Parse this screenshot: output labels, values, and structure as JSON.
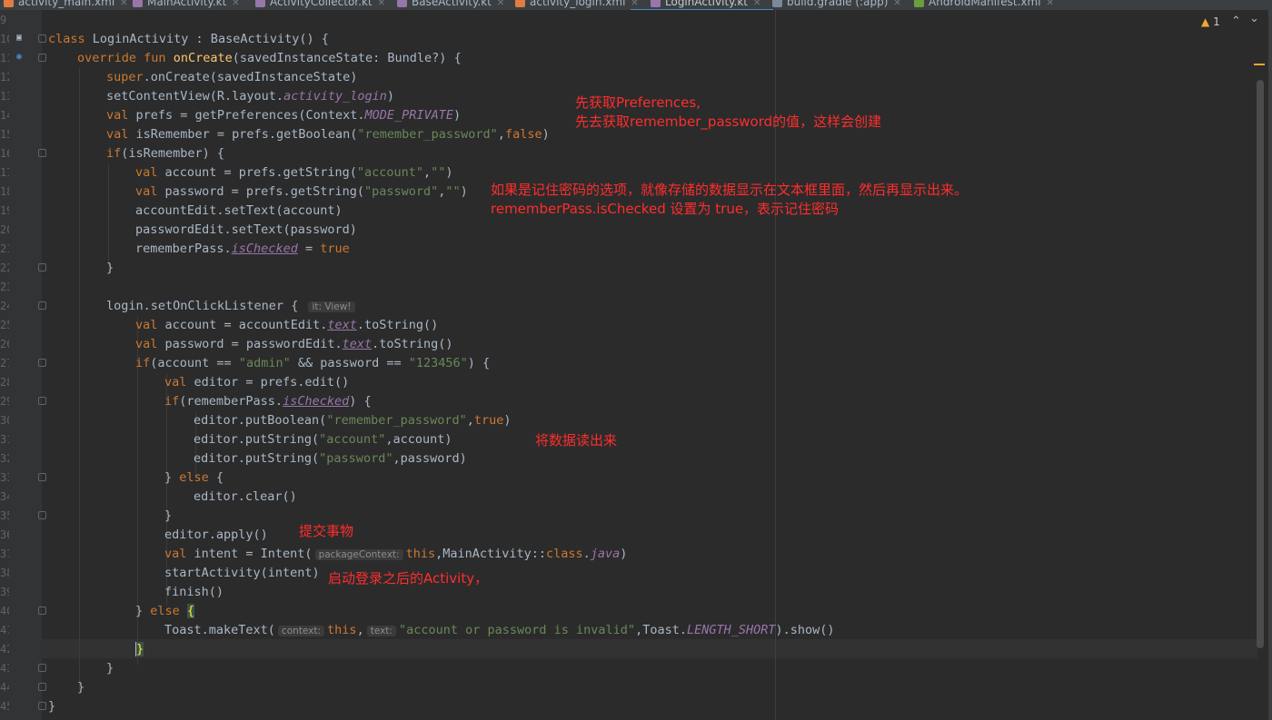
{
  "tabs": [
    {
      "label": "activity_main.xml",
      "icon_color": "#e37c41"
    },
    {
      "label": "MainActivity.kt",
      "icon_color": "#9876aa"
    },
    {
      "label": "ActivityCollector.kt",
      "icon_color": "#9876aa"
    },
    {
      "label": "BaseActivity.kt",
      "icon_color": "#9876aa"
    },
    {
      "label": "activity_login.xml",
      "icon_color": "#e37c41"
    },
    {
      "label": "LoginActivity.kt",
      "icon_color": "#9876aa",
      "active": true
    },
    {
      "label": "build.gradle (:app)",
      "icon_color": "#7a8a99"
    },
    {
      "label": "AndroidManifest.xml",
      "icon_color": "#6a9f3e"
    }
  ],
  "warnings": {
    "icon": "warning-triangle-icon",
    "count": "1"
  },
  "line_numbers": [
    "9",
    "10",
    "11",
    "12",
    "13",
    "14",
    "15",
    "16",
    "17",
    "18",
    "19",
    "20",
    "21",
    "22",
    "23",
    "24",
    "25",
    "26",
    "27",
    "28",
    "29",
    "30",
    "31",
    "32",
    "33",
    "34",
    "35",
    "36",
    "37",
    "38",
    "39",
    "40",
    "41",
    "42",
    "43",
    "44",
    "45"
  ],
  "code": {
    "l10": {
      "kw1": "class",
      "t1": " LoginActivity : BaseActivity() {"
    },
    "l11": {
      "kw1": "override",
      "kw2": "fun",
      "fn": "onCreate",
      "t1": "(savedInstanceState: Bundle?) {"
    },
    "l12": {
      "kw1": "super",
      "t1": ".onCreate(savedInstanceState)"
    },
    "l13": {
      "t1": "setContentView(R.layout.",
      "prop": "activity_login",
      "t2": ")"
    },
    "l14": {
      "kw1": "val",
      "t1": " prefs = getPreferences(Context.",
      "prop": "MODE_PRIVATE",
      "t2": ")"
    },
    "l15": {
      "kw1": "val",
      "t1": " isRemember = prefs.getBoolean(",
      "str": "\"remember_password\"",
      "t2": ",",
      "kw2": "false",
      "t3": ")"
    },
    "l16": {
      "kw1": "if",
      "t1": "(isRemember) {"
    },
    "l17": {
      "kw1": "val",
      "t1": " account = prefs.getString(",
      "str1": "\"account\"",
      "t2": ",",
      "str2": "\"\"",
      "t3": ")"
    },
    "l18": {
      "kw1": "val",
      "t1": " password = prefs.getString(",
      "str1": "\"password\"",
      "t2": ",",
      "str2": "\"\"",
      "t3": ")"
    },
    "l19": {
      "t1": "accountEdit.setText(account)"
    },
    "l20": {
      "t1": "passwordEdit.setText(password)"
    },
    "l21": {
      "t1": "rememberPass.",
      "prop": "isChecked",
      "t2": " = ",
      "kw1": "true"
    },
    "l22": {
      "t1": "}"
    },
    "l24": {
      "t1": "login.setOnClickListener { ",
      "hint": "it: View!"
    },
    "l25": {
      "kw1": "val",
      "t1": " account = accountEdit.",
      "prop": "text",
      "t2": ".toString()"
    },
    "l26": {
      "kw1": "val",
      "t1": " password = passwordEdit.",
      "prop": "text",
      "t2": ".toString()"
    },
    "l27": {
      "kw1": "if",
      "t1": "(account == ",
      "str1": "\"admin\"",
      "t2": " && password == ",
      "str2": "\"123456\"",
      "t3": ") {"
    },
    "l28": {
      "kw1": "val",
      "t1": " editor = prefs.edit()"
    },
    "l29": {
      "kw1": "if",
      "t1": "(rememberPass.",
      "prop": "isChecked",
      "t2": ") {"
    },
    "l30": {
      "t1": "editor.putBoolean(",
      "str": "\"remember_password\"",
      "t2": ",",
      "kw1": "true",
      "t3": ")"
    },
    "l31": {
      "t1": "editor.putString(",
      "str": "\"account\"",
      "t2": ",account)"
    },
    "l32": {
      "t1": "editor.putString(",
      "str": "\"password\"",
      "t2": ",password)"
    },
    "l33": {
      "t1": "} ",
      "kw1": "else",
      "t2": " {"
    },
    "l34": {
      "t1": "editor.clear()"
    },
    "l35": {
      "t1": "}"
    },
    "l36": {
      "t1": "editor.apply()"
    },
    "l37": {
      "kw1": "val",
      "t1": " intent = Intent(",
      "hint": "packageContext:",
      "kw2": "this",
      "t2": ",MainActivity::",
      "kw3": "class",
      "t3": ".",
      "prop": "java",
      "t4": ")"
    },
    "l38": {
      "t1": "startActivity(intent)"
    },
    "l39": {
      "t1": "finish()"
    },
    "l40": {
      "t1": "} ",
      "kw1": "else",
      "t2": " ",
      "brace": "{"
    },
    "l41": {
      "t1": "Toast.makeText(",
      "hint1": "context:",
      "kw1": "this",
      "t2": ",",
      "hint2": "text:",
      "str": "\"account or password is invalid\"",
      "t3": ",Toast.",
      "prop": "LENGTH_SHORT",
      "t4": ").show()"
    },
    "l42": {
      "brace": "}"
    },
    "l43": {
      "t1": "}"
    },
    "l44": {
      "t1": "}"
    },
    "l45": {
      "t1": "}"
    }
  },
  "annotations": {
    "a1_line1": "先获取Preferences,",
    "a1_line2": "先去获取remember_password的值，这样会创建",
    "a2_line1": "如果是记住密码的选项，就像存储的数据显示在文本框里面，然后再显示出来。",
    "a2_line2": "rememberPass.isChecked 设置为 true，表示记住密码",
    "a3": "将数据读出来",
    "a4": "提交事物",
    "a5": "启动登录之后的Activity，"
  }
}
